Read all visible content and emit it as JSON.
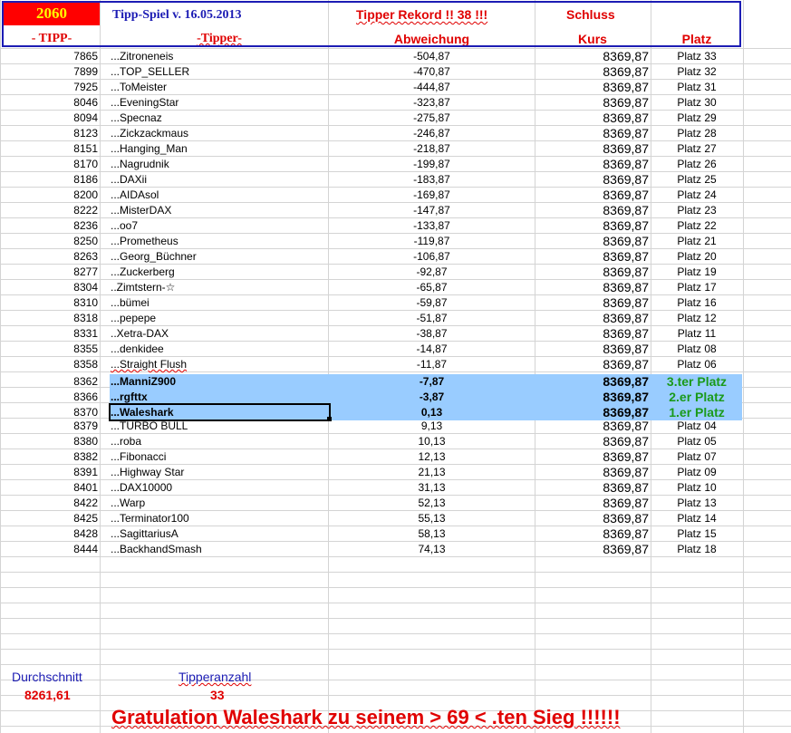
{
  "header": {
    "year_box": "2060",
    "game_title": "Tipp-Spiel v. 16.05.2013",
    "record_text": "Tipper Rekord !!  38  !!!",
    "schluss_label": "Schluss",
    "col_tipp": "- TIPP-",
    "col_tipper": "-Tipper-",
    "col_abweichung": "Abweichung",
    "col_kurs": "Kurs",
    "col_platz": "Platz"
  },
  "rows": [
    {
      "tipp": "7865",
      "tipper": "...Zitroneneis",
      "abw": "-504,87",
      "kurs": "8369,87",
      "platz": "Platz 33"
    },
    {
      "tipp": "7899",
      "tipper": "...TOP_SELLER",
      "abw": "-470,87",
      "kurs": "8369,87",
      "platz": "Platz 32"
    },
    {
      "tipp": "7925",
      "tipper": "...ToMeister",
      "abw": "-444,87",
      "kurs": "8369,87",
      "platz": "Platz 31"
    },
    {
      "tipp": "8046",
      "tipper": "...EveningStar",
      "abw": "-323,87",
      "kurs": "8369,87",
      "platz": "Platz 30"
    },
    {
      "tipp": "8094",
      "tipper": "...Specnaz",
      "abw": "-275,87",
      "kurs": "8369,87",
      "platz": "Platz 29"
    },
    {
      "tipp": "8123",
      "tipper": "...Zickzackmaus",
      "abw": "-246,87",
      "kurs": "8369,87",
      "platz": "Platz 28"
    },
    {
      "tipp": "8151",
      "tipper": "...Hanging_Man",
      "abw": "-218,87",
      "kurs": "8369,87",
      "platz": "Platz 27"
    },
    {
      "tipp": "8170",
      "tipper": "...Nagrudnik",
      "abw": "-199,87",
      "kurs": "8369,87",
      "platz": "Platz 26"
    },
    {
      "tipp": "8186",
      "tipper": "...DAXii",
      "abw": "-183,87",
      "kurs": "8369,87",
      "platz": "Platz 25"
    },
    {
      "tipp": "8200",
      "tipper": "...AIDAsol",
      "abw": "-169,87",
      "kurs": "8369,87",
      "platz": "Platz 24"
    },
    {
      "tipp": "8222",
      "tipper": "...MisterDAX",
      "abw": "-147,87",
      "kurs": "8369,87",
      "platz": "Platz 23"
    },
    {
      "tipp": "8236",
      "tipper": "...oo7",
      "abw": "-133,87",
      "kurs": "8369,87",
      "platz": "Platz 22"
    },
    {
      "tipp": "8250",
      "tipper": "...Prometheus",
      "abw": "-119,87",
      "kurs": "8369,87",
      "platz": "Platz 21"
    },
    {
      "tipp": "8263",
      "tipper": "...Georg_Büchner",
      "abw": "-106,87",
      "kurs": "8369,87",
      "platz": "Platz 20"
    },
    {
      "tipp": "8277",
      "tipper": "...Zuckerberg",
      "abw": "-92,87",
      "kurs": "8369,87",
      "platz": "Platz 19"
    },
    {
      "tipp": "8304",
      "tipper": "..Zimtstern-☆",
      "abw": "-65,87",
      "kurs": "8369,87",
      "platz": "Platz 17"
    },
    {
      "tipp": "8310",
      "tipper": "...bümei",
      "abw": "-59,87",
      "kurs": "8369,87",
      "platz": "Platz 16"
    },
    {
      "tipp": "8318",
      "tipper": "...pepepe",
      "abw": "-51,87",
      "kurs": "8369,87",
      "platz": "Platz 12"
    },
    {
      "tipp": "8331",
      "tipper": "..Xetra-DAX",
      "abw": "-38,87",
      "kurs": "8369,87",
      "platz": "Platz 11"
    },
    {
      "tipp": "8355",
      "tipper": "...denkidee",
      "abw": "-14,87",
      "kurs": "8369,87",
      "platz": "Platz 08"
    },
    {
      "tipp": "8358",
      "tipper": "...Straight Flush",
      "abw": "-11,87",
      "kurs": "8369,87",
      "platz": "Platz 06"
    },
    {
      "tipp": "8362",
      "tipper": "...ManniZ900",
      "abw": "-7,87",
      "kurs": "8369,87",
      "platz": "3.ter Platz"
    },
    {
      "tipp": "8366",
      "tipper": "...rgfttx",
      "abw": "-3,87",
      "kurs": "8369,87",
      "platz": "2.er Platz"
    },
    {
      "tipp": "8370",
      "tipper": "...Waleshark",
      "abw": "0,13",
      "kurs": "8369,87",
      "platz": "1.er Platz"
    },
    {
      "tipp": "8379",
      "tipper": "...TURBO BULL",
      "abw": "9,13",
      "kurs": "8369,87",
      "platz": "Platz 04"
    },
    {
      "tipp": "8380",
      "tipper": "...roba",
      "abw": "10,13",
      "kurs": "8369,87",
      "platz": "Platz 05"
    },
    {
      "tipp": "8382",
      "tipper": "...Fibonacci",
      "abw": "12,13",
      "kurs": "8369,87",
      "platz": "Platz 07"
    },
    {
      "tipp": "8391",
      "tipper": "...Highway Star",
      "abw": "21,13",
      "kurs": "8369,87",
      "platz": "Platz 09"
    },
    {
      "tipp": "8401",
      "tipper": "...DAX10000",
      "abw": "31,13",
      "kurs": "8369,87",
      "platz": "Platz 10"
    },
    {
      "tipp": "8422",
      "tipper": "...Warp",
      "abw": "52,13",
      "kurs": "8369,87",
      "platz": "Platz 13"
    },
    {
      "tipp": "8425",
      "tipper": "...Terminator100",
      "abw": "55,13",
      "kurs": "8369,87",
      "platz": "Platz 14"
    },
    {
      "tipp": "8428",
      "tipper": "...SagittariusA",
      "abw": "58,13",
      "kurs": "8369,87",
      "platz": "Platz 15"
    },
    {
      "tipp": "8444",
      "tipper": "...BackhandSmash",
      "abw": "74,13",
      "kurs": "8369,87",
      "platz": "Platz 18"
    }
  ],
  "footer": {
    "avg_label": "Durchschnitt",
    "avg_value": "8261,61",
    "count_label": "Tipperanzahl",
    "count_value": "33",
    "congrats": "Gratulation Waleshark  zu seinem > 69 < .ten Sieg !!!!!!"
  },
  "colors": {
    "year_box_bg": "#ff0000",
    "year_box_text": "#ffff00",
    "header_red": "#e00000",
    "header_blue": "#1c1cb4",
    "highlight": "#99ccff",
    "winner_green": "#1a9a1a"
  }
}
